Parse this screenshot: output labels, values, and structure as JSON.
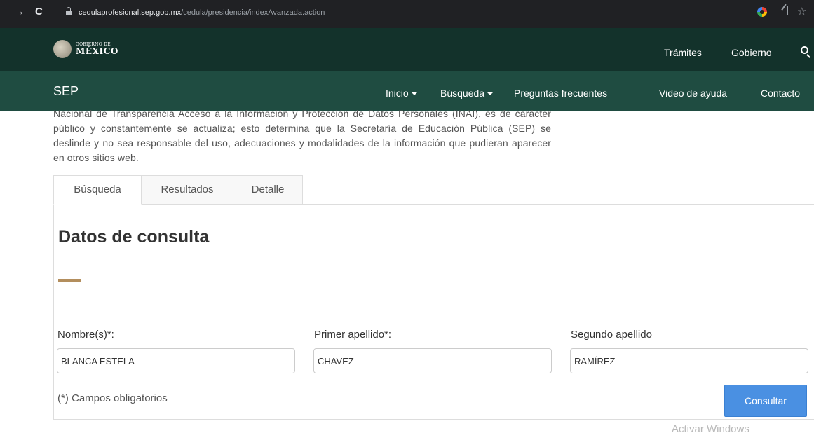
{
  "browser": {
    "url_domain": "cedulaprofesional.sep.gob.mx",
    "url_path": "/cedula/presidencia/indexAvanzada.action",
    "back_glyph": "→",
    "reload_glyph": "C",
    "star_glyph": "☆"
  },
  "gob_header": {
    "logo_small": "GOBIERNO DE",
    "logo_big": "MÉXICO",
    "links": [
      "Trámites",
      "Gobierno"
    ]
  },
  "sep_nav": {
    "title": "SEP",
    "items": [
      "Inicio",
      "Búsqueda",
      "Preguntas frecuentes",
      "Video de ayuda",
      "Contacto"
    ]
  },
  "intro": {
    "line0": "Nacional de Transparencia Acceso a la Información y Protección de Datos Personales (INAI), es",
    "text": "de carácter público y constantemente se actualiza; esto determina que la Secretaría de Educación Pública (SEP) se deslinde y no sea responsable del uso, adecuaciones y modalidades de la información que pudieran aparecer en otros sitios web."
  },
  "tabs": [
    "Búsqueda",
    "Resultados",
    "Detalle"
  ],
  "panel": {
    "title": "Datos de consulta",
    "fields": [
      {
        "label": "Nombre(s)*:",
        "value": "BLANCA ESTELA"
      },
      {
        "label": "Primer apellido*:",
        "value": "CHAVEZ"
      },
      {
        "label": "Segundo apellido",
        "value": "RAMÍREZ"
      }
    ],
    "required_note": "(*) Campos obligatorios",
    "submit_label": "Consultar"
  },
  "watermark": "Activar Windows",
  "colors": {
    "gob_header": "#13322b",
    "sep_nav": "#1f4c41",
    "accent": "#b38e5d",
    "button": "#4a90e2"
  }
}
